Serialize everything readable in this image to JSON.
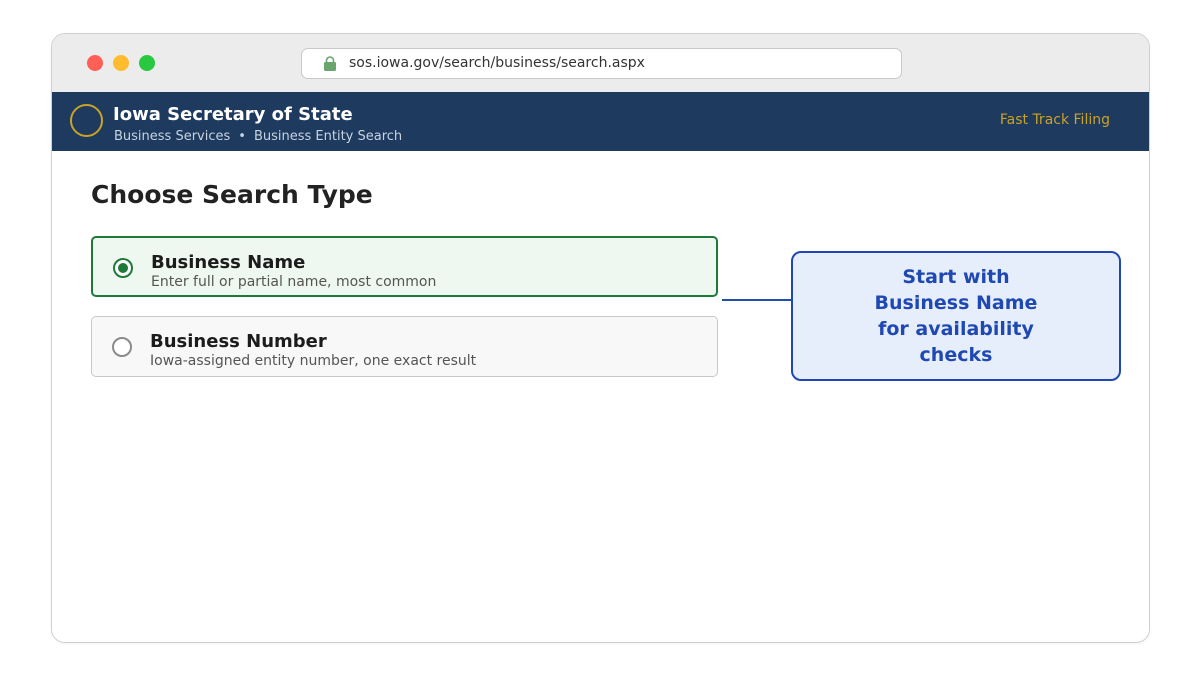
{
  "browser": {
    "url": "sos.iowa.gov/search/business/search.aspx"
  },
  "header": {
    "title": "Iowa Secretary of State",
    "breadcrumb": [
      "Business Services",
      "Business Entity Search"
    ],
    "breadcrumb_separator": "•",
    "fast_track_label": "Fast Track Filing"
  },
  "main": {
    "heading": "Choose Search Type",
    "options": [
      {
        "title": "Business Name",
        "description": "Enter full or partial name, most common",
        "selected": true
      },
      {
        "title": "Business Number",
        "description": "Iowa-assigned entity number, one exact result",
        "selected": false
      }
    ]
  },
  "callout": {
    "text": "Start with Business Name for availability checks"
  },
  "colors": {
    "header_bg": "#1e3a5f",
    "accent_gold": "#c9a227",
    "selected_green": "#1f7a3a",
    "callout_blue": "#2048b3"
  },
  "icons": {
    "lock": "lock-icon",
    "seal": "state-seal-icon"
  }
}
